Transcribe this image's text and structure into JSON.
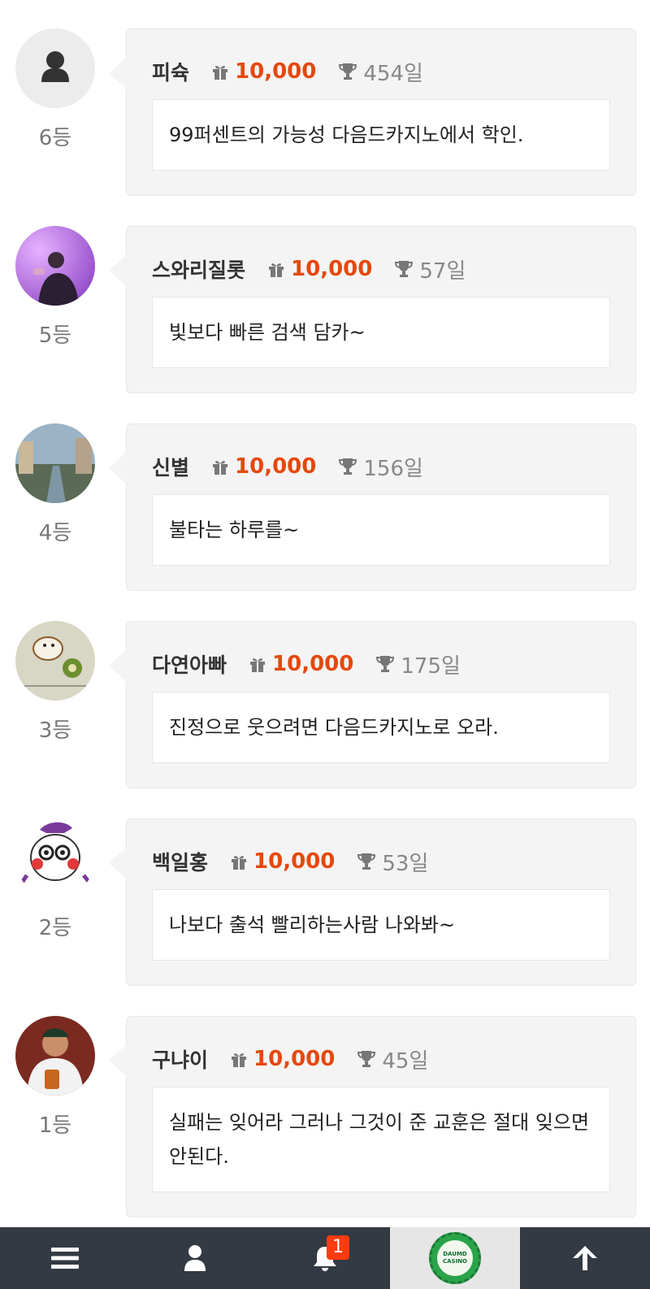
{
  "entries": [
    {
      "rank": "6등",
      "nickname": "피슉",
      "points": "10,000",
      "days": "454일",
      "comment": "99퍼센트의 가능성 다음드카지노에서 학인.",
      "avatar": "default-user"
    },
    {
      "rank": "5등",
      "nickname": "스와리질롯",
      "points": "10,000",
      "days": "57일",
      "comment": "빛보다 빠른 검색 담카~",
      "avatar": "photo-purple"
    },
    {
      "rank": "4등",
      "nickname": "신별",
      "points": "10,000",
      "days": "156일",
      "comment": "불타는 하루를~",
      "avatar": "photo-canal"
    },
    {
      "rank": "3등",
      "nickname": "다연아빠",
      "points": "10,000",
      "days": "175일",
      "comment": "진정으로 웃으려면 다음드카지노로 오라.",
      "avatar": "drawing-hamster"
    },
    {
      "rank": "2등",
      "nickname": "백일홍",
      "points": "10,000",
      "days": "53일",
      "comment": "나보다 출석 빨리하는사람 나와봐~",
      "avatar": "cartoon-character"
    },
    {
      "rank": "1등",
      "nickname": "구냐이",
      "points": "10,000",
      "days": "45일",
      "comment": "실패는 잊어라 그러나 그것이 준 교훈은 절대 잊으면 안된다.",
      "avatar": "photo-person"
    }
  ],
  "bottom_nav": {
    "items": [
      "menu-icon",
      "user-icon",
      "bell-icon",
      "casino-logo",
      "arrow-up-icon"
    ],
    "notification_count": "1",
    "casino_logo_text": "DAUMD CASINO"
  },
  "colors": {
    "points": "#e5480c",
    "bottom_bar": "#333a44",
    "bubble": "#f4f4f4",
    "badge": "#ff3b0f"
  }
}
